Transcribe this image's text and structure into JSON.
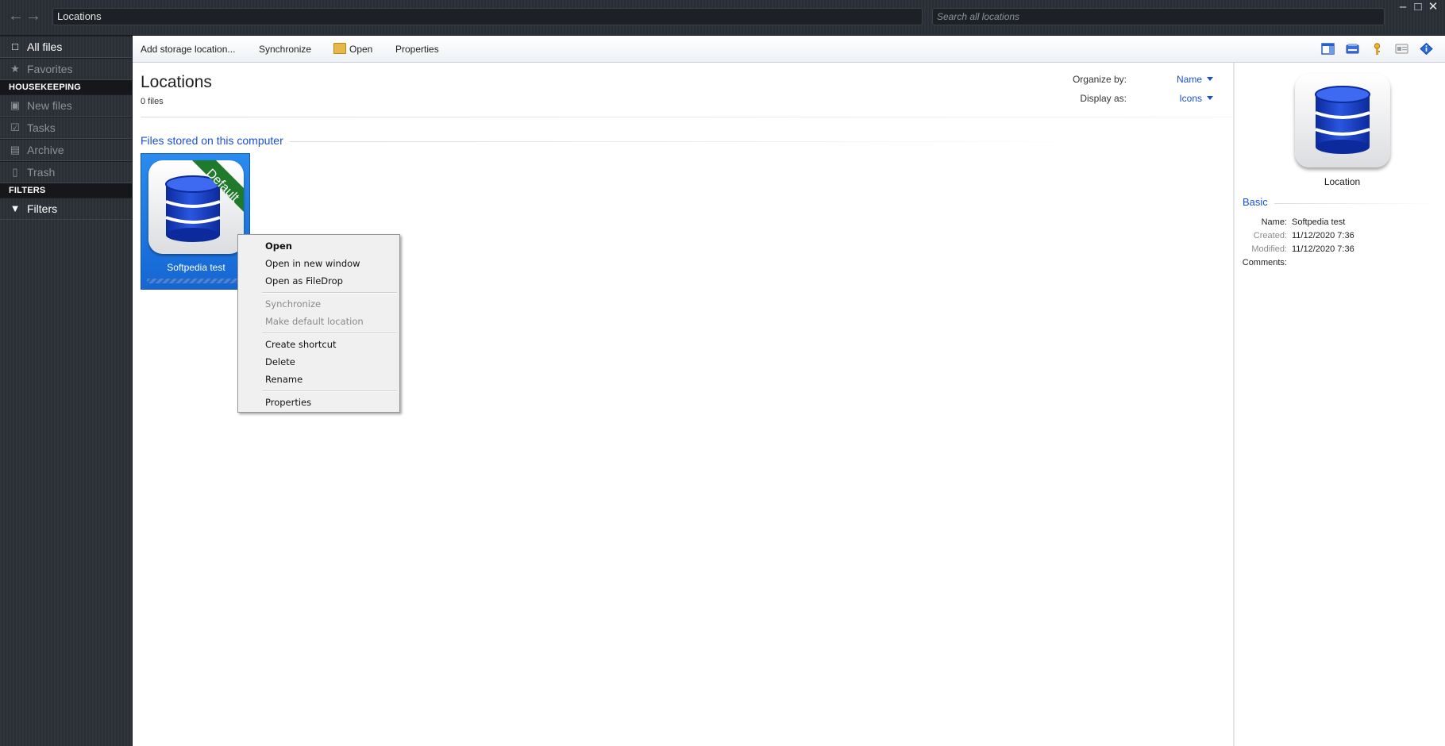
{
  "window": {
    "address": "Locations",
    "search_placeholder": "Search all locations",
    "min": "–",
    "max": "□",
    "close": "✕"
  },
  "sidebar": {
    "all_files": "All files",
    "favorites": "Favorites",
    "housekeeping_head": "HOUSEKEEPING",
    "new_files": "New files",
    "tasks": "Tasks",
    "archive": "Archive",
    "trash": "Trash",
    "filters_head": "FILTERS",
    "filters": "Filters"
  },
  "toolbar": {
    "add_storage": "Add storage location...",
    "synchronize": "Synchronize",
    "open": "Open",
    "properties": "Properties"
  },
  "content": {
    "title": "Locations",
    "file_count": "0 files",
    "organize_label": "Organize by:",
    "organize_value": "Name",
    "display_label": "Display as:",
    "display_value": "Icons",
    "group_title": "Files stored on this computer",
    "tile": {
      "label": "Softpedia test",
      "ribbon": "Default"
    }
  },
  "context_menu": {
    "open": "Open",
    "open_new_window": "Open in new window",
    "open_filedrop": "Open as FileDrop",
    "synchronize": "Synchronize",
    "make_default": "Make default location",
    "create_shortcut": "Create shortcut",
    "delete": "Delete",
    "rename": "Rename",
    "properties": "Properties"
  },
  "details": {
    "caption": "Location",
    "section": "Basic",
    "name_key": "Name:",
    "name_val": "Softpedia test",
    "created_key": "Created:",
    "created_val": "11/12/2020 7:36",
    "modified_key": "Modified:",
    "modified_val": "11/12/2020 7:36",
    "comments_key": "Comments:"
  },
  "colors": {
    "accent": "#1a4fd6",
    "tile_selected": "#1f78e6",
    "ribbon": "#1f7a2c",
    "db_blue": "#1636b8"
  }
}
